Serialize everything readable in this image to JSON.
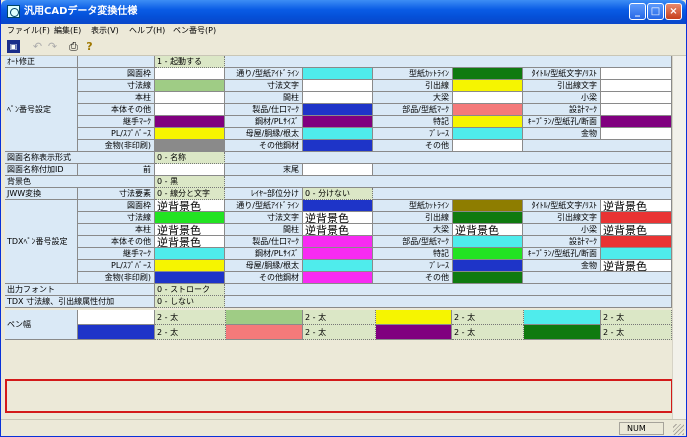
{
  "window": {
    "title": "汎用CADデータ変換仕様"
  },
  "menu": [
    "ファイル(F)",
    "編集(E)",
    "表示(V)",
    "ヘルプ(H)",
    "ペン番号(P)"
  ],
  "status": {
    "num": "NUM"
  },
  "colors": {
    "white": "#ffffff",
    "green": "#9fcc85",
    "red": "#e93333",
    "cyan": "#4fecec",
    "blue": "#1e34c8",
    "yellow": "#f6f500",
    "purple": "#80007f",
    "gray": "#8a8a8a",
    "olive": "#8e7d00",
    "dkgreen": "#0f7a0f",
    "lime": "#22e322",
    "magenta": "#f72bf2",
    "pink": "#f47a7a"
  },
  "grid": {
    "autofix_label": "ｵｰﾄ修正",
    "autofix_value": "1 - 起動する",
    "pen_label": "ﾍﾟﾝ番号設定",
    "pen_rows": [
      [
        "図面枠",
        "通り/型紙ｱｲﾄﾞﾗｲﾝ",
        "型紙ｶｯﾄﾗｲﾝ",
        "ﾀｲﾄﾙ/型紙文字/ﾘｽﾄ"
      ],
      [
        "寸法線",
        "寸法文字",
        "引出線",
        "引出線文字"
      ],
      [
        "本柱",
        "間柱",
        "大梁",
        "小梁"
      ],
      [
        "本体その他",
        "製品/仕口ﾏｰｸ",
        "部品/型紙ﾏｰｸ",
        "設計ﾏｰｸ"
      ],
      [
        "継手ﾏｰｸ",
        "鋼材/PLｻｲｽﾞ",
        "特記",
        "ｷｰﾌﾟﾗﾝ/型紙孔/断面"
      ],
      [
        "PL/ｽﾌﾟﾊﾞｰｽ",
        "母屋/胴縁/根太",
        "ﾌﾞﾚｰｽ",
        "金物"
      ],
      [
        "金物(非印刷)",
        "その他鋼材",
        "その他"
      ]
    ],
    "namefmt_label": "図面名称表示形式",
    "namefmt_value": "0 - 名称",
    "nameadd_label": "図面名称付加ID",
    "nameadd_front": "前",
    "nameadd_back": "末尾",
    "bg_label": "背景色",
    "bg_value": "0 - 黒",
    "jww_label": "JWW変換",
    "dim_elem_label": "寸法要素",
    "dim_elem_value": "0 - 線分と文字",
    "layer_label": "ﾚｲﾔｰ部位分け",
    "layer_value": "0 - 分けない",
    "tdx_label": "TDXﾍﾟﾝ番号設定",
    "bgtext": "逆背景色",
    "font_label": "出力フォント",
    "font_value": "0 - ストローク",
    "tdx_dim_label": "TDX 寸法線、引出線属性付加",
    "tdx_dim_value": "0 - しない",
    "penw_label": "ペン幅",
    "penw_value": "2 - 太"
  }
}
